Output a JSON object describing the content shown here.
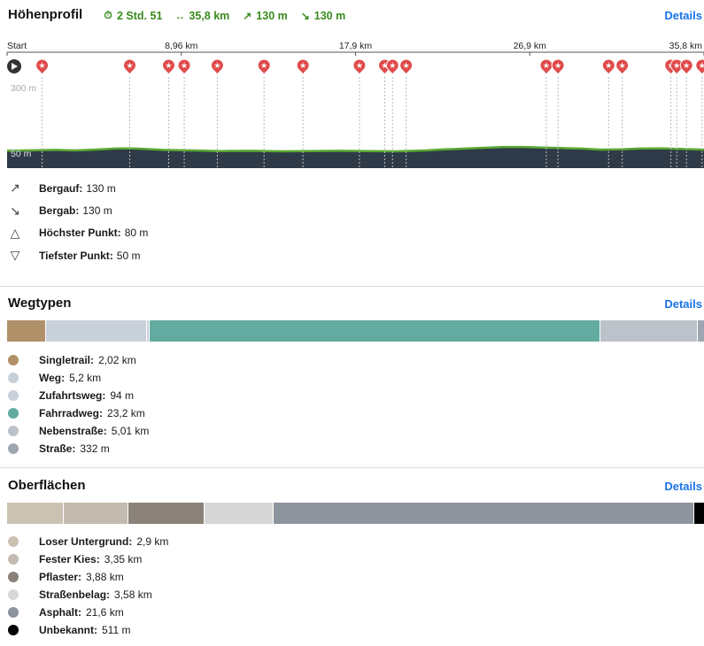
{
  "elevation": {
    "title": "Höhenprofil",
    "details": "Details",
    "stats": {
      "duration": "2 Std. 51",
      "distance": "35,8 km",
      "ascent": "130 m",
      "descent": "130 m"
    },
    "axis_labels": [
      "Start",
      "8,96 km",
      "17,9 km",
      "26,9 km",
      "35,8 km"
    ],
    "y_top_label": "300 m",
    "y_bottom_label": "50 m",
    "colors": {
      "ground": "#2e3a48",
      "line": "#5aa832",
      "marker": "#e04b4b"
    },
    "summary": [
      {
        "icon": "arrow-up-right-icon",
        "label": "Bergauf:",
        "value": "130 m"
      },
      {
        "icon": "arrow-down-right-icon",
        "label": "Bergab:",
        "value": "130 m"
      },
      {
        "icon": "triangle-up-icon",
        "label": "Höchster Punkt:",
        "value": "80 m"
      },
      {
        "icon": "triangle-down-icon",
        "label": "Tiefster Punkt:",
        "value": "50 m"
      }
    ]
  },
  "chart_data": {
    "type": "area",
    "x": [
      0,
      1.5,
      2.5,
      3.5,
      4.5,
      5.5,
      6.3,
      7,
      8,
      9.5,
      11,
      12.5,
      14,
      15.5,
      17,
      18.5,
      20,
      21.5,
      22.5,
      23.5,
      24.5,
      25.5,
      26.5,
      27.5,
      28.5,
      29.5,
      30.5,
      31.5,
      32.5,
      33.5,
      34.5,
      35.8
    ],
    "y": [
      62,
      64,
      65,
      63,
      66,
      70,
      71,
      69,
      65,
      63,
      61,
      62,
      60,
      61,
      62,
      61,
      60,
      63,
      67,
      70,
      73,
      76,
      76,
      74,
      72,
      70,
      66,
      67,
      70,
      71,
      69,
      66
    ],
    "xlim": [
      0,
      35.8
    ],
    "ylim": [
      50,
      300
    ],
    "waypoints_km": [
      1.8,
      6.3,
      8.3,
      9.1,
      10.8,
      13.2,
      15.2,
      18.1,
      19.4,
      19.8,
      20.5,
      27.7,
      28.3,
      30.9,
      31.6,
      34.1,
      34.4,
      34.9,
      35.7
    ]
  },
  "wegtypen": {
    "title": "Wegtypen",
    "details": "Details",
    "items": [
      {
        "label": "Singletrail:",
        "value": "2,02 km",
        "km": 2.02,
        "color": "#b09068"
      },
      {
        "label": "Weg:",
        "value": "5,2 km",
        "km": 5.2,
        "color": "#c8d0da"
      },
      {
        "label": "Zufahrtsweg:",
        "value": "94 m",
        "km": 0.094,
        "color": "#c8d0da"
      },
      {
        "label": "Fahrradweg:",
        "value": "23,2 km",
        "km": 23.2,
        "color": "#63aaa0"
      },
      {
        "label": "Nebenstraße:",
        "value": "5,01 km",
        "km": 5.01,
        "color": "#bcc2c9"
      },
      {
        "label": "Straße:",
        "value": "332 m",
        "km": 0.332,
        "color": "#9ea6b2"
      }
    ]
  },
  "oberflaechen": {
    "title": "Oberflächen",
    "details": "Details",
    "items": [
      {
        "label": "Loser Untergrund:",
        "value": "2,9 km",
        "km": 2.9,
        "color": "#cbc2b2"
      },
      {
        "label": "Fester Kies:",
        "value": "3,35 km",
        "km": 3.35,
        "color": "#c4bbb0"
      },
      {
        "label": "Pflaster:",
        "value": "3,88 km",
        "km": 3.88,
        "color": "#8a8278"
      },
      {
        "label": "Straßenbelag:",
        "value": "3,58 km",
        "km": 3.58,
        "color": "#d7d7d7"
      },
      {
        "label": "Asphalt:",
        "value": "21,6 km",
        "km": 21.6,
        "color": "#8e949e"
      },
      {
        "label": "Unbekannt:",
        "value": "511 m",
        "km": 0.511,
        "color": "#000000"
      }
    ]
  }
}
